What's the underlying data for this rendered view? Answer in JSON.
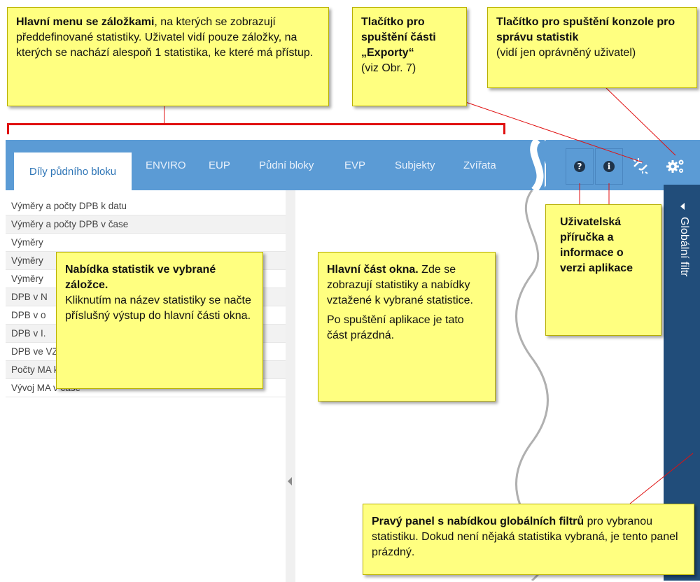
{
  "tabs": [
    {
      "label": "Díly půdního bloku",
      "active": true
    },
    {
      "label": "ENVIRO"
    },
    {
      "label": "EUP"
    },
    {
      "label": "Půdní bloky"
    },
    {
      "label": "EVP"
    },
    {
      "label": "Subjekty"
    },
    {
      "label": "Zvířata"
    }
  ],
  "toolbar": {
    "help_icon": "question-circle",
    "info_icon": "info-circle",
    "export_icon": "broken-link",
    "console_icon": "gears",
    "help_glyph": "?",
    "info_glyph": "i"
  },
  "statistics": [
    "Výměry a počty DPB k datu",
    "Výměry a počty DPB v čase",
    "Výměry",
    "Výměry",
    "Výměry",
    "DPB v N",
    "DPB v o",
    "DPB v I.",
    "DPB ve VZCHO (průniky a počty)",
    "Počty MA k datu",
    "Vývoj MA v čase"
  ],
  "right_panel": {
    "label": "Globální filtr"
  },
  "callouts": {
    "menu": {
      "bold": "Hlavní menu se záložkami",
      "text": ", na kterých se zobrazují předdefinované statistiky. Uživatel vidí pouze záložky, na kterých se nachází alespoň 1 statistika, ke které má přístup."
    },
    "exports": {
      "bold": "Tlačítko pro spuštění části „Exporty“",
      "text": "(viz Obr. 7)"
    },
    "console": {
      "bold": "Tlačítko pro spuštění konzole pro správu statistik",
      "text": "(vidí jen oprávněný uživatel)"
    },
    "stat_menu": {
      "bold": "Nabídka statistik ve vybrané záložce.",
      "text": "Kliknutím na název statistiky se načte příslušný výstup do hlavní části okna."
    },
    "main": {
      "bold": "Hlavní část okna.",
      "text1": "Zde se zobrazují statistiky a nabídky vztažené k vybrané statistice.",
      "text2": "Po spuštění aplikace je tato část prázdná."
    },
    "help": {
      "bold": "Uživatelská příručka a informace o verzi aplikace"
    },
    "right_panel": {
      "bold": "Pravý panel s nabídkou globálních filtrů",
      "text": "pro vybranou statistiku. Dokud není nějaká statistika vybraná, je tento panel prázdný."
    }
  },
  "colors": {
    "tabbar": "#5b9bd5",
    "right_panel": "#214d7a",
    "callout": "#ffff80",
    "bracket": "#e01010"
  }
}
